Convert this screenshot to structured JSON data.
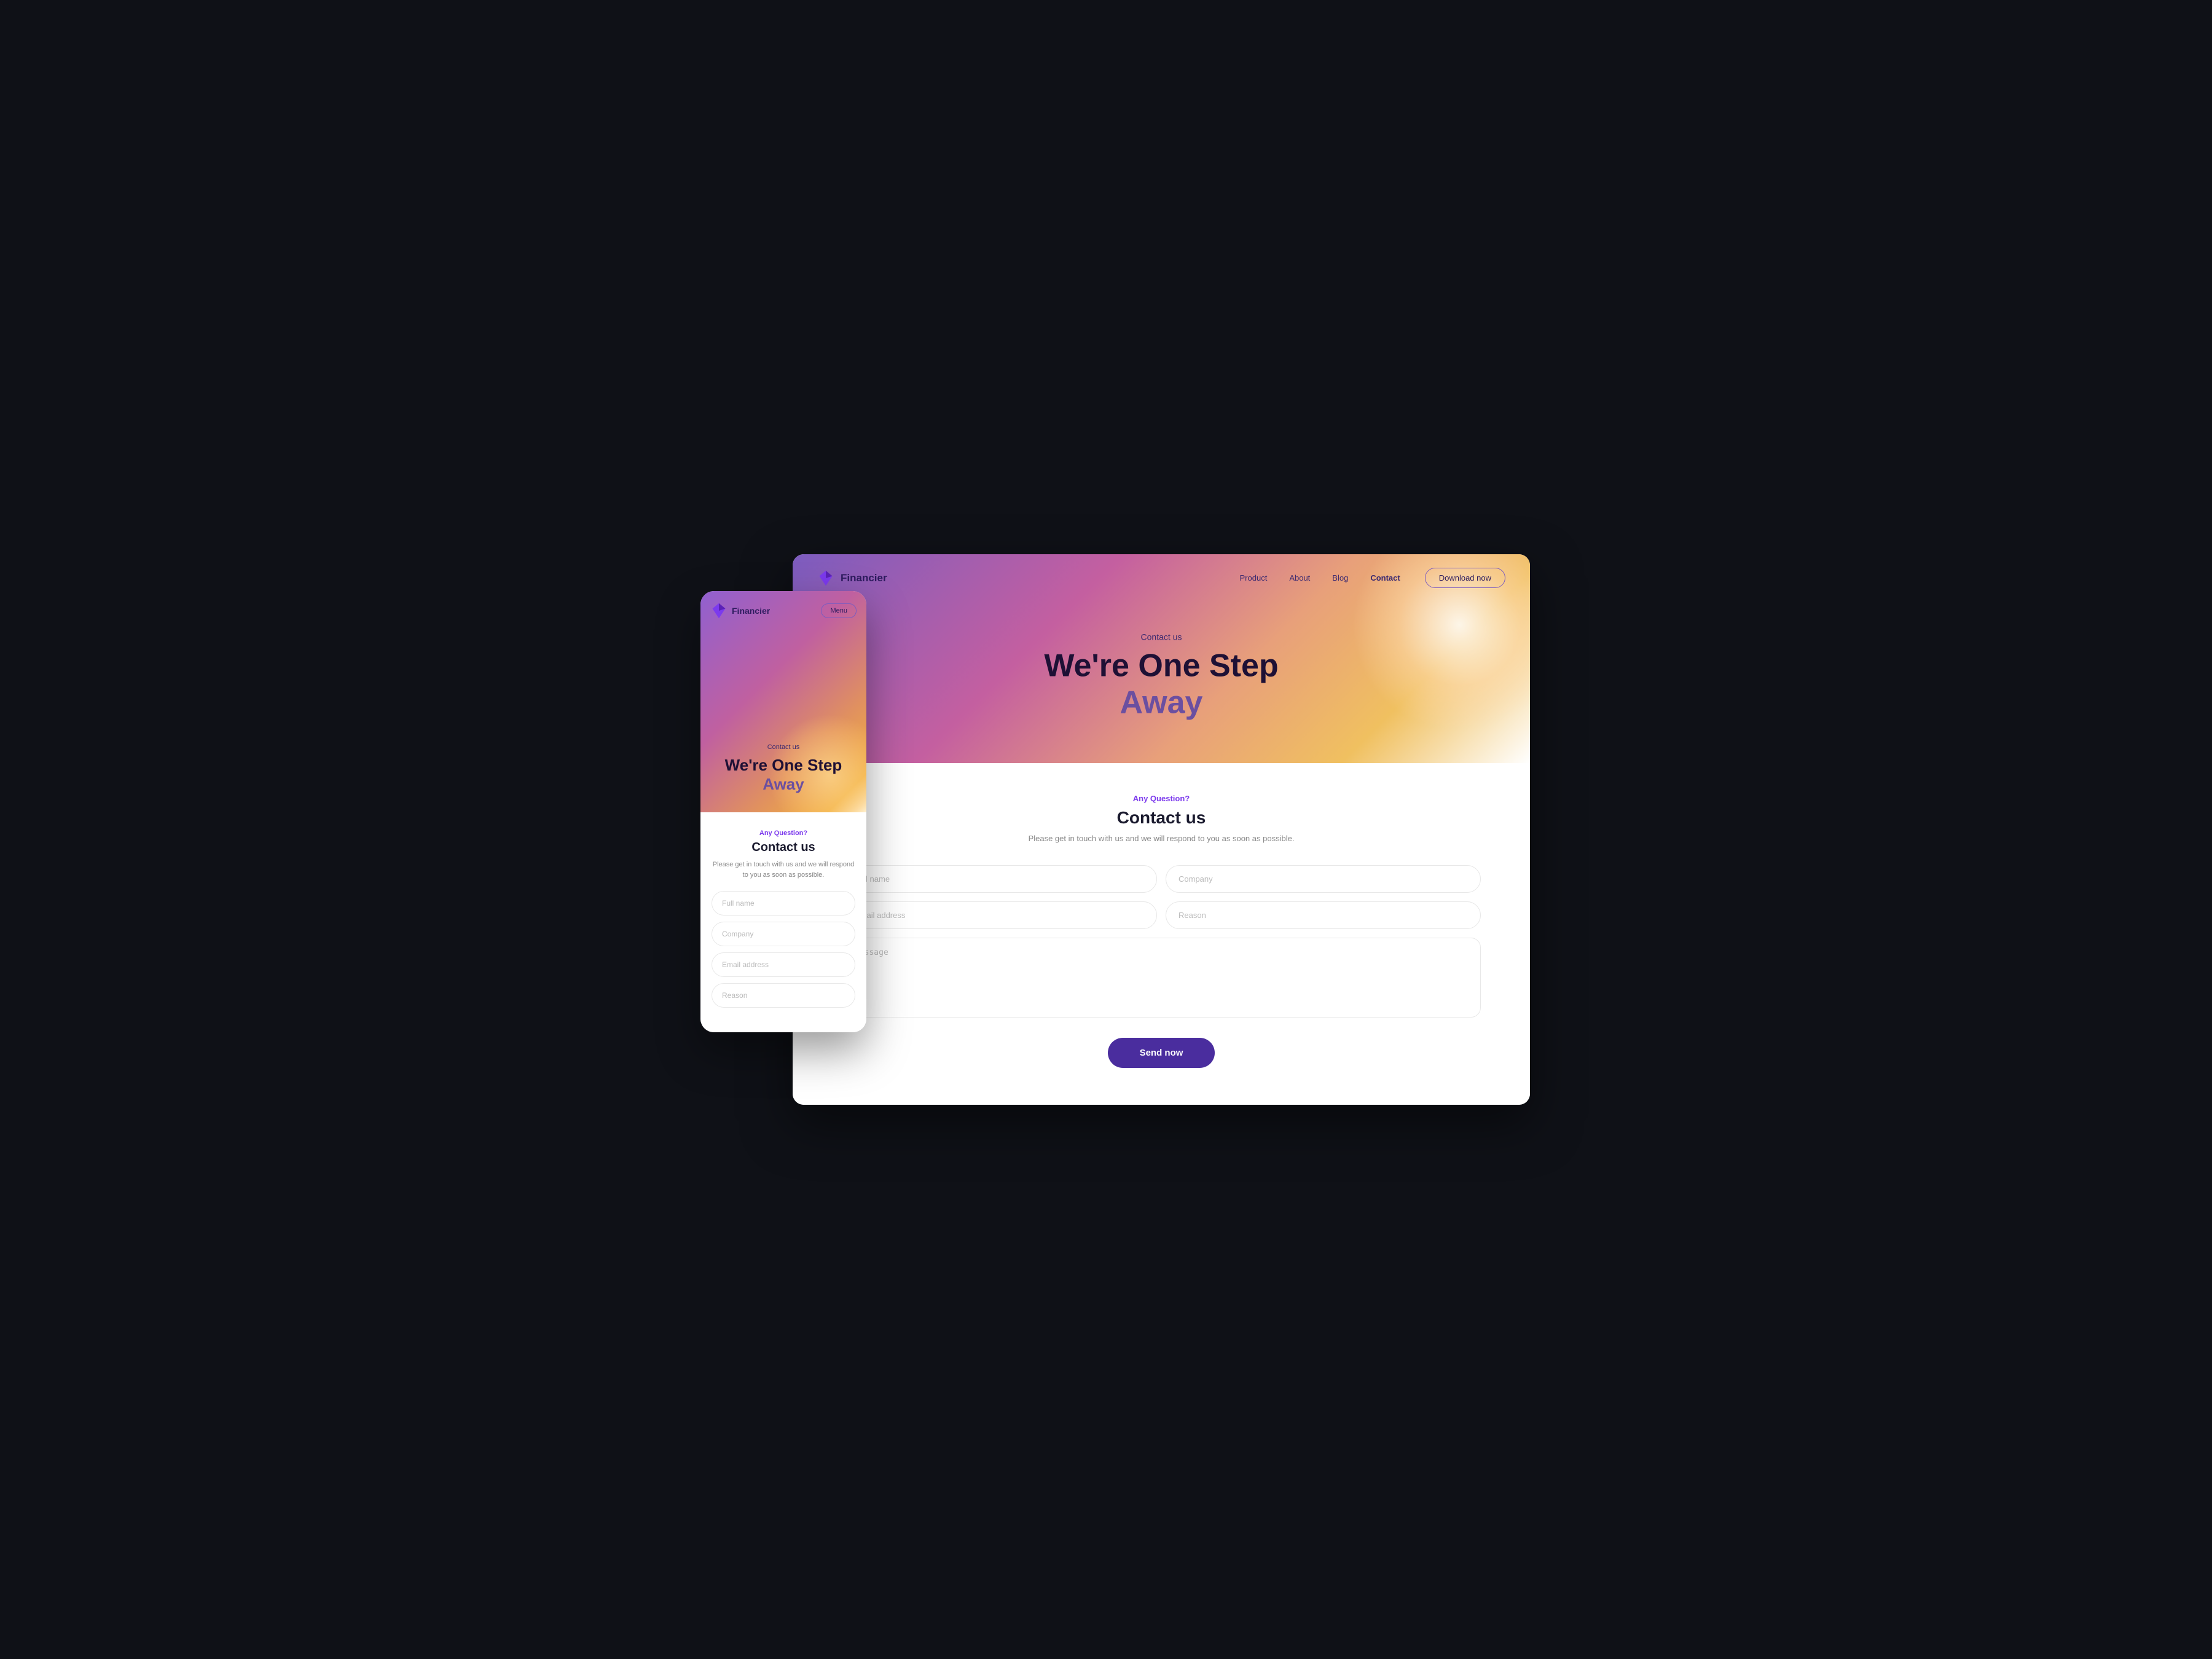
{
  "desktop": {
    "nav": {
      "logo_text": "Financier",
      "links": [
        "Product",
        "About",
        "Blog",
        "Contact"
      ],
      "active_link": "Contact",
      "download_btn": "Download now"
    },
    "hero": {
      "eyebrow": "Contact us",
      "title_line1": "We're One Step",
      "title_line2": "Away"
    },
    "form": {
      "eyebrow": "Any Question?",
      "title": "Contact us",
      "subtitle": "Please get in touch with us and we will respond to you as soon as possible.",
      "fields": {
        "full_name_placeholder": "Full name",
        "company_placeholder": "Company",
        "email_placeholder": "Email address",
        "reason_placeholder": "Reason",
        "message_placeholder": "Message"
      },
      "send_btn": "Send now"
    }
  },
  "mobile": {
    "nav": {
      "logo_text": "Financier",
      "menu_btn": "Menu"
    },
    "hero": {
      "eyebrow": "Contact us",
      "title_line1": "We're One Step",
      "title_line2": "Away"
    },
    "form": {
      "eyebrow": "Any Question?",
      "title": "Contact us",
      "subtitle": "Please get in touch with us and we will respond to you as soon as possible.",
      "fields": {
        "full_name_placeholder": "Full name",
        "company_placeholder": "Company",
        "email_placeholder": "Email address",
        "reason_placeholder": "Reason"
      }
    }
  },
  "icons": {
    "logo_diamond_color_top": "#9b6ee8",
    "logo_diamond_color_bottom": "#5b2fa8"
  }
}
